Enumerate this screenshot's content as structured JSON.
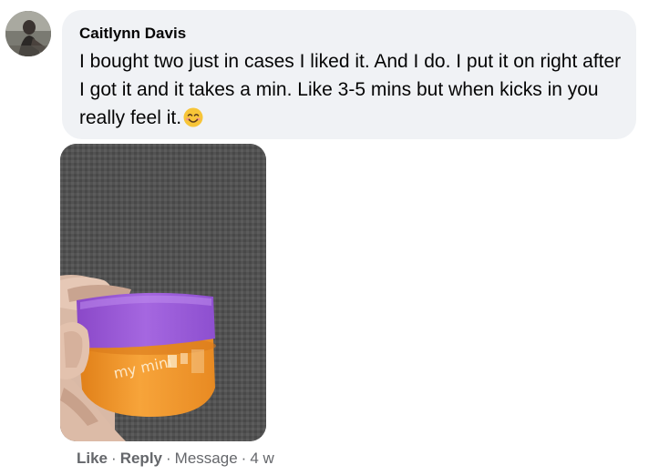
{
  "comment": {
    "author": "Caitlynn Davis",
    "text": "I bought two just in cases I liked it. And I do. I put it on right after I got it and it takes a min. Like 3-5 mins but when kicks in you really feel it.",
    "emoji": "smiling-face-icon",
    "photo_label_text": "my mini"
  },
  "actions": {
    "like_label": "Like",
    "separator": "·",
    "reply_label": "Reply",
    "message_label": "Message",
    "timestamp": "4 w"
  },
  "colors": {
    "bubble_bg": "#f0f2f5",
    "meta_text": "#65676b",
    "jar_lid": "#9b59d6",
    "jar_body": "#f39a2d"
  }
}
